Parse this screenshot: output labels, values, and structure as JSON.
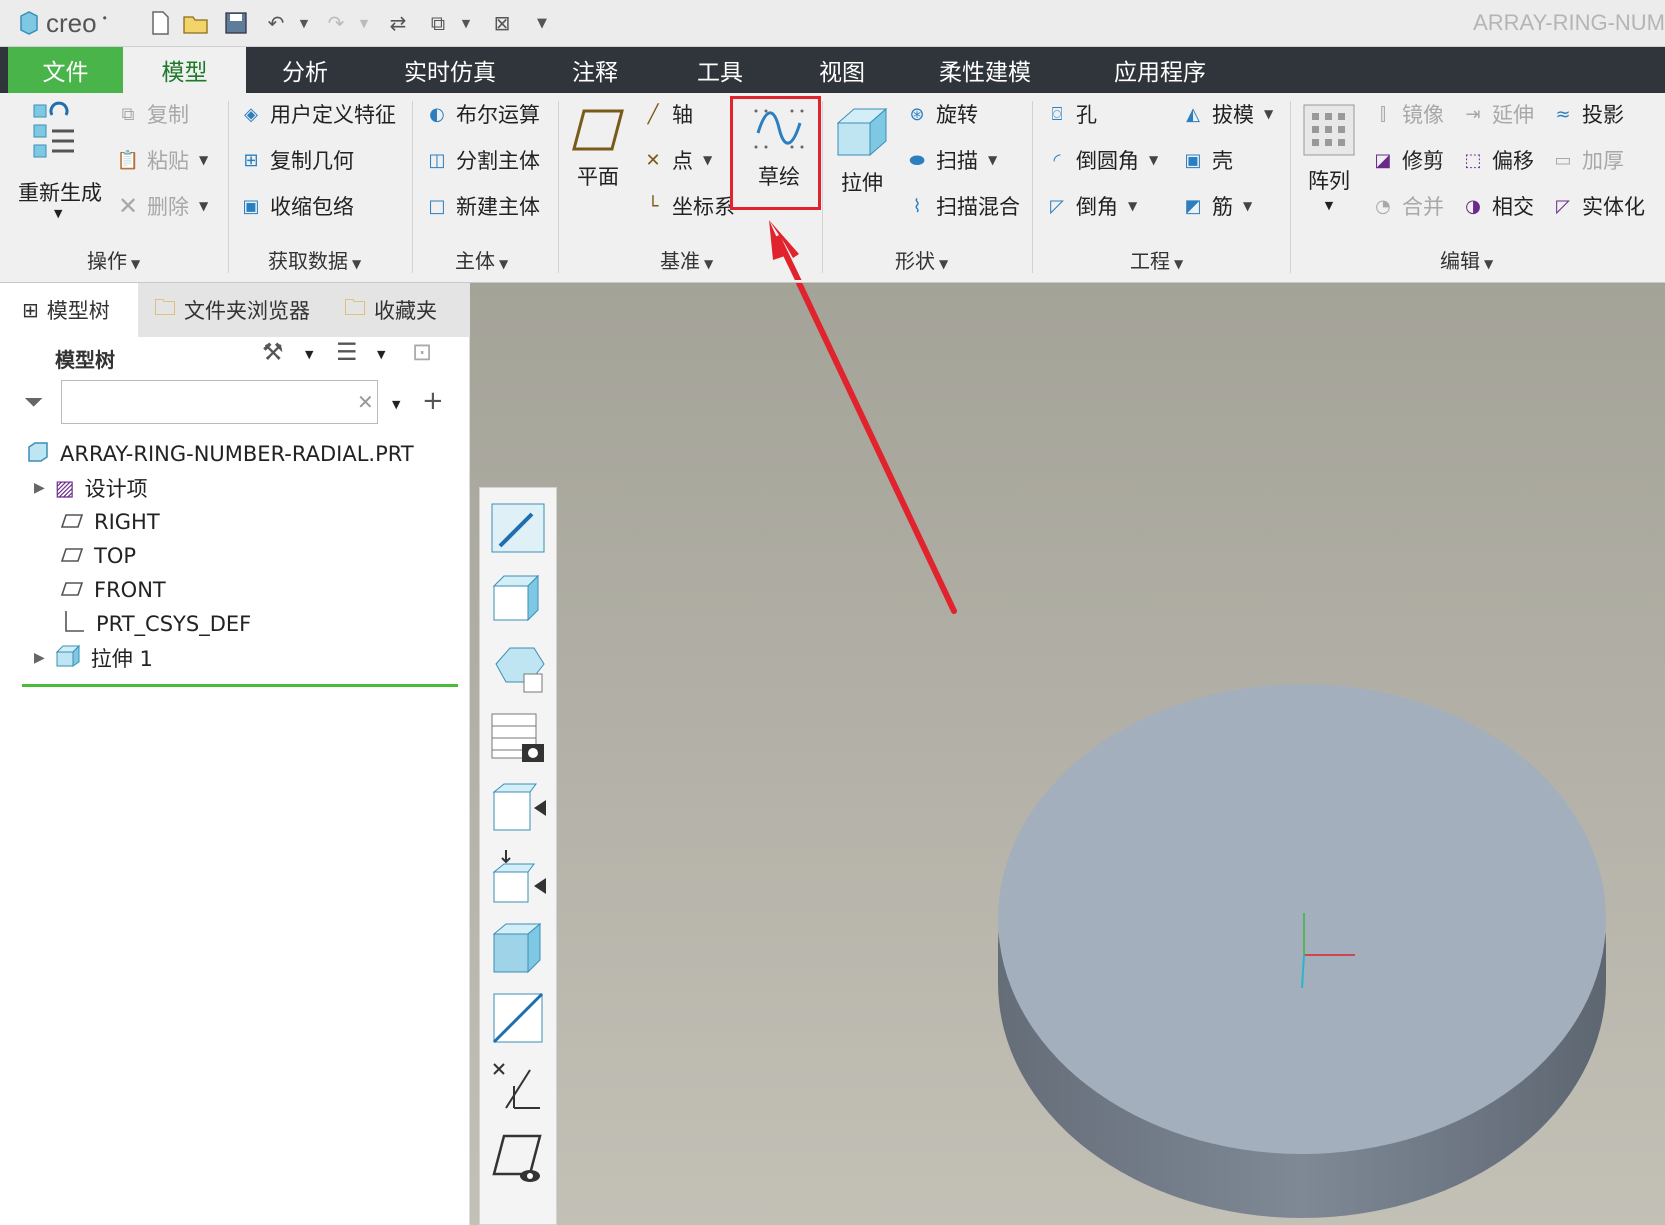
{
  "app": {
    "logo_text": "creo",
    "window_title": "ARRAY-RING-NUM"
  },
  "menu": {
    "file": "文件",
    "tabs": [
      "模型",
      "分析",
      "实时仿真",
      "注释",
      "工具",
      "视图",
      "柔性建模",
      "应用程序"
    ],
    "active": "模型"
  },
  "ribbon": {
    "groups": [
      "操作",
      "获取数据",
      "主体",
      "基准",
      "形状",
      "工程",
      "编辑"
    ],
    "operations": {
      "regenerate": "重新生成",
      "copy": "复制",
      "paste": "粘贴",
      "delete": "删除"
    },
    "get_data": {
      "udf": "用户定义特征",
      "copy_geom": "复制几何",
      "shrinkwrap": "收缩包络"
    },
    "body": {
      "boolean": "布尔运算",
      "split": "分割主体",
      "new_body": "新建主体"
    },
    "datum": {
      "plane": "平面",
      "axis": "轴",
      "point": "点",
      "csys": "坐标系",
      "sketch": "草绘"
    },
    "shapes": {
      "extrude": "拉伸",
      "revolve": "旋转",
      "sweep": "扫描",
      "swept_blend": "扫描混合"
    },
    "engineering": {
      "hole": "孔",
      "round": "倒圆角",
      "chamfer": "倒角",
      "draft": "拔模",
      "shell": "壳",
      "rib": "筋"
    },
    "editing": {
      "pattern": "阵列",
      "mirror": "镜像",
      "extend": "延伸",
      "project": "投影",
      "trim": "修剪",
      "offset": "偏移",
      "thicken": "加厚",
      "merge": "合并",
      "intersect": "相交",
      "solidify": "实体化"
    }
  },
  "pane": {
    "tabs": [
      "模型树",
      "文件夹浏览器",
      "收藏夹"
    ],
    "header": "模型树",
    "search_value": "",
    "tree": [
      {
        "label": "ARRAY-RING-NUMBER-RADIAL.PRT"
      },
      {
        "label": "设计项"
      },
      {
        "label": "RIGHT"
      },
      {
        "label": "TOP"
      },
      {
        "label": "FRONT"
      },
      {
        "label": "PRT_CSYS_DEF"
      },
      {
        "label": "拉伸 1"
      }
    ]
  },
  "colors": {
    "menubar": "#2f353a",
    "file_tab": "#49b449",
    "active_tab_text": "#1e7a2a",
    "highlight": "#e0232d",
    "disk_top": "#a3afbd",
    "disk_side": "#6f7a87"
  }
}
